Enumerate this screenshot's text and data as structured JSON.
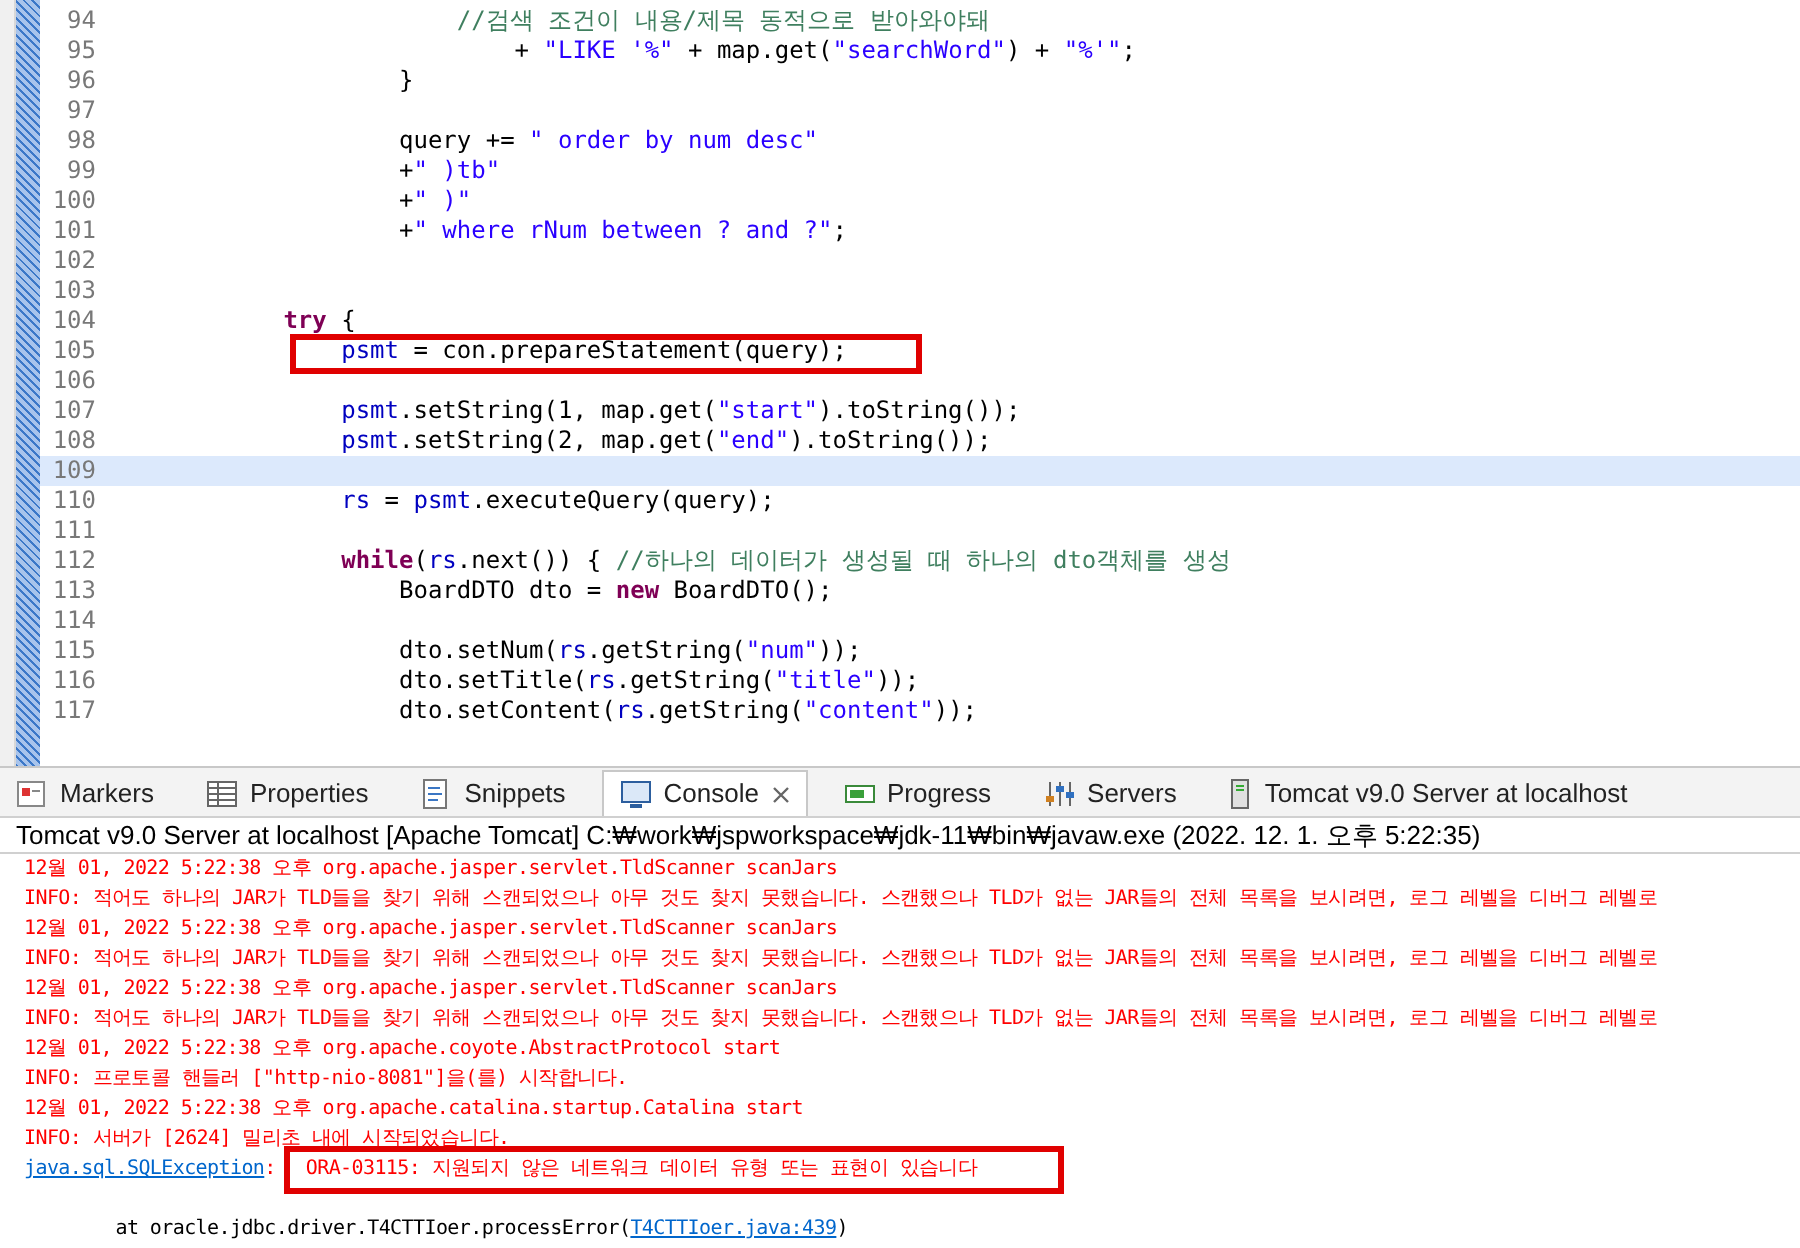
{
  "editor": {
    "lines": [
      {
        "number": "94",
        "current": false,
        "highlighted": false,
        "tokens": [
          {
            "kind": "comment",
            "text": "                        //검색 조건이 내용/제목 동적으로 받아와야돼"
          }
        ]
      },
      {
        "number": "95",
        "current": false,
        "highlighted": false,
        "tokens": [
          {
            "kind": "text",
            "text": "                            + "
          },
          {
            "kind": "string",
            "text": "\"LIKE '%\""
          },
          {
            "kind": "text",
            "text": " + map.get("
          },
          {
            "kind": "string",
            "text": "\"searchWord\""
          },
          {
            "kind": "text",
            "text": ") + "
          },
          {
            "kind": "string",
            "text": "\"%'\""
          },
          {
            "kind": "text",
            "text": ";"
          }
        ]
      },
      {
        "number": "96",
        "current": false,
        "highlighted": false,
        "tokens": [
          {
            "kind": "text",
            "text": "                    }"
          }
        ]
      },
      {
        "number": "97",
        "current": false,
        "highlighted": false
      },
      {
        "number": "98",
        "current": false,
        "highlighted": false,
        "tokens": [
          {
            "kind": "text",
            "text": "                    query += "
          },
          {
            "kind": "string",
            "text": "\" order by num desc\""
          }
        ]
      },
      {
        "number": "99",
        "current": false,
        "highlighted": false,
        "tokens": [
          {
            "kind": "text",
            "text": "                    +"
          },
          {
            "kind": "string",
            "text": "\" )tb\""
          }
        ]
      },
      {
        "number": "100",
        "current": false,
        "highlighted": false,
        "tokens": [
          {
            "kind": "text",
            "text": "                    +"
          },
          {
            "kind": "string",
            "text": "\" )\""
          }
        ]
      },
      {
        "number": "101",
        "current": false,
        "highlighted": false,
        "tokens": [
          {
            "kind": "text",
            "text": "                    +"
          },
          {
            "kind": "string",
            "text": "\" where rNum between ? and ?\""
          },
          {
            "kind": "text",
            "text": ";"
          }
        ]
      },
      {
        "number": "102",
        "current": false,
        "highlighted": false
      },
      {
        "number": "103",
        "current": false,
        "highlighted": false
      },
      {
        "number": "104",
        "current": false,
        "highlighted": false,
        "tokens": [
          {
            "kind": "keyword",
            "text": "            try"
          },
          {
            "kind": "text",
            "text": " {"
          }
        ]
      },
      {
        "number": "105",
        "current": false,
        "highlighted": true,
        "tokens": [
          {
            "kind": "field",
            "text": "                psmt"
          },
          {
            "kind": "text",
            "text": " = con.prepareStatement(query);"
          }
        ]
      },
      {
        "number": "106",
        "current": false,
        "highlighted": false
      },
      {
        "number": "107",
        "current": false,
        "highlighted": false,
        "tokens": [
          {
            "kind": "field",
            "text": "                psmt"
          },
          {
            "kind": "text",
            "text": ".setString(1, map.get("
          },
          {
            "kind": "string",
            "text": "\"start\""
          },
          {
            "kind": "text",
            "text": ").toString());"
          }
        ]
      },
      {
        "number": "108",
        "current": false,
        "highlighted": false,
        "tokens": [
          {
            "kind": "field",
            "text": "                psmt"
          },
          {
            "kind": "text",
            "text": ".setString(2, map.get("
          },
          {
            "kind": "string",
            "text": "\"end\""
          },
          {
            "kind": "text",
            "text": ").toString());"
          }
        ]
      },
      {
        "number": "109",
        "current": true,
        "highlighted": false
      },
      {
        "number": "110",
        "current": false,
        "highlighted": false,
        "tokens": [
          {
            "kind": "field",
            "text": "                rs"
          },
          {
            "kind": "text",
            "text": " = "
          },
          {
            "kind": "field",
            "text": "psmt"
          },
          {
            "kind": "text",
            "text": ".executeQuery(query);"
          }
        ]
      },
      {
        "number": "111",
        "current": false,
        "highlighted": false
      },
      {
        "number": "112",
        "current": false,
        "highlighted": false,
        "tokens": [
          {
            "kind": "keyword",
            "text": "                while"
          },
          {
            "kind": "text",
            "text": "("
          },
          {
            "kind": "field",
            "text": "rs"
          },
          {
            "kind": "text",
            "text": ".next()) { "
          },
          {
            "kind": "comment",
            "text": "//하나의 데이터가 생성될 때 하나의 dto객체를 생성"
          }
        ]
      },
      {
        "number": "113",
        "current": false,
        "highlighted": false,
        "tokens": [
          {
            "kind": "text",
            "text": "                    BoardDTO dto = "
          },
          {
            "kind": "keyword",
            "text": "new"
          },
          {
            "kind": "text",
            "text": " BoardDTO();"
          }
        ]
      },
      {
        "number": "114",
        "current": false,
        "highlighted": false
      },
      {
        "number": "115",
        "current": false,
        "highlighted": false,
        "tokens": [
          {
            "kind": "text",
            "text": "                    dto.setNum("
          },
          {
            "kind": "field",
            "text": "rs"
          },
          {
            "kind": "text",
            "text": ".getString("
          },
          {
            "kind": "string",
            "text": "\"num\""
          },
          {
            "kind": "text",
            "text": "));"
          }
        ]
      },
      {
        "number": "116",
        "current": false,
        "highlighted": false,
        "tokens": [
          {
            "kind": "text",
            "text": "                    dto.setTitle("
          },
          {
            "kind": "field",
            "text": "rs"
          },
          {
            "kind": "text",
            "text": ".getString("
          },
          {
            "kind": "string",
            "text": "\"title\""
          },
          {
            "kind": "text",
            "text": "));"
          }
        ]
      },
      {
        "number": "117",
        "current": false,
        "highlighted": false,
        "tokens": [
          {
            "kind": "text",
            "text": "                    dto.setContent("
          },
          {
            "kind": "field",
            "text": "rs"
          },
          {
            "kind": "text",
            "text": ".getString("
          },
          {
            "kind": "string",
            "text": "\"content\""
          },
          {
            "kind": "text",
            "text": "));"
          }
        ]
      }
    ]
  },
  "tabs": [
    {
      "label": "Markers",
      "selected": false,
      "closable": false
    },
    {
      "label": "Properties",
      "selected": false,
      "closable": false
    },
    {
      "label": "Snippets",
      "selected": false,
      "closable": false
    },
    {
      "label": "Console",
      "selected": true,
      "closable": true
    },
    {
      "label": "Progress",
      "selected": false,
      "closable": false
    },
    {
      "label": "Servers",
      "selected": false,
      "closable": false
    },
    {
      "label": "Tomcat v9.0 Server at localhost",
      "selected": false,
      "closable": false
    }
  ],
  "console": {
    "title": "Tomcat v9.0 Server at localhost [Apache Tomcat] C:₩work₩jspworkspace₩jdk-11₩bin₩javaw.exe  (2022. 12. 1. 오후 5:22:35)",
    "lines": [
      {
        "kind": "err",
        "segments": [
          {
            "kind": "text",
            "text": "12월 01, 2022 5:22:38 오후 org.apache.jasper.servlet.TldScanner scanJars",
            "boxed": false
          }
        ]
      },
      {
        "kind": "err",
        "segments": [
          {
            "kind": "text",
            "text": "INFO: 적어도 하나의 JAR가 TLD들을 찾기 위해 스캔되었으나 아무 것도 찾지 못했습니다. 스캔했으나 TLD가 없는 JAR들의 전체 목록을 보시려면, 로그 레벨을 디버그 레벨로",
            "boxed": false
          }
        ]
      },
      {
        "kind": "err",
        "segments": [
          {
            "kind": "text",
            "text": "12월 01, 2022 5:22:38 오후 org.apache.jasper.servlet.TldScanner scanJars",
            "boxed": false
          }
        ]
      },
      {
        "kind": "err",
        "segments": [
          {
            "kind": "text",
            "text": "INFO: 적어도 하나의 JAR가 TLD들을 찾기 위해 스캔되었으나 아무 것도 찾지 못했습니다. 스캔했으나 TLD가 없는 JAR들의 전체 목록을 보시려면, 로그 레벨을 디버그 레벨로",
            "boxed": false
          }
        ]
      },
      {
        "kind": "err",
        "segments": [
          {
            "kind": "text",
            "text": "12월 01, 2022 5:22:38 오후 org.apache.jasper.servlet.TldScanner scanJars",
            "boxed": false
          }
        ]
      },
      {
        "kind": "err",
        "segments": [
          {
            "kind": "text",
            "text": "INFO: 적어도 하나의 JAR가 TLD들을 찾기 위해 스캔되었으나 아무 것도 찾지 못했습니다. 스캔했으나 TLD가 없는 JAR들의 전체 목록을 보시려면, 로그 레벨을 디버그 레벨로",
            "boxed": false
          }
        ]
      },
      {
        "kind": "err",
        "segments": [
          {
            "kind": "text",
            "text": "12월 01, 2022 5:22:38 오후 org.apache.coyote.AbstractProtocol start",
            "boxed": false
          }
        ]
      },
      {
        "kind": "err",
        "segments": [
          {
            "kind": "text",
            "text": "INFO: 프로토콜 핸들러 [\"http-nio-8081\"]을(를) 시작합니다.",
            "boxed": false
          }
        ]
      },
      {
        "kind": "err",
        "segments": [
          {
            "kind": "text",
            "text": "12월 01, 2022 5:22:38 오후 org.apache.catalina.startup.Catalina start",
            "boxed": false
          }
        ]
      },
      {
        "kind": "err",
        "segments": [
          {
            "kind": "text",
            "text": "INFO: 서버가 [2624] 밀리초 내에 시작되었습니다.",
            "boxed": false
          }
        ]
      },
      {
        "kind": "err",
        "segments": [
          {
            "kind": "link",
            "text": "java.sql.SQLException",
            "boxed": false
          },
          {
            "kind": "text",
            "text": ":",
            "boxed": false
          },
          {
            "kind": "text",
            "text": "ORA-03115: 지원되지 않은 네트워크 데이터 유형 또는 표현이 있습니다",
            "boxed": true
          }
        ]
      },
      {
        "kind": "blank"
      },
      {
        "kind": "out",
        "segments": [
          {
            "kind": "text",
            "text": "        at oracle.jdbc.driver.T4CTTIoer.processError(",
            "boxed": false
          },
          {
            "kind": "link",
            "text": "T4CTTIoer.java:439",
            "boxed": false
          },
          {
            "kind": "text",
            "text": ")",
            "boxed": false
          }
        ]
      }
    ]
  }
}
